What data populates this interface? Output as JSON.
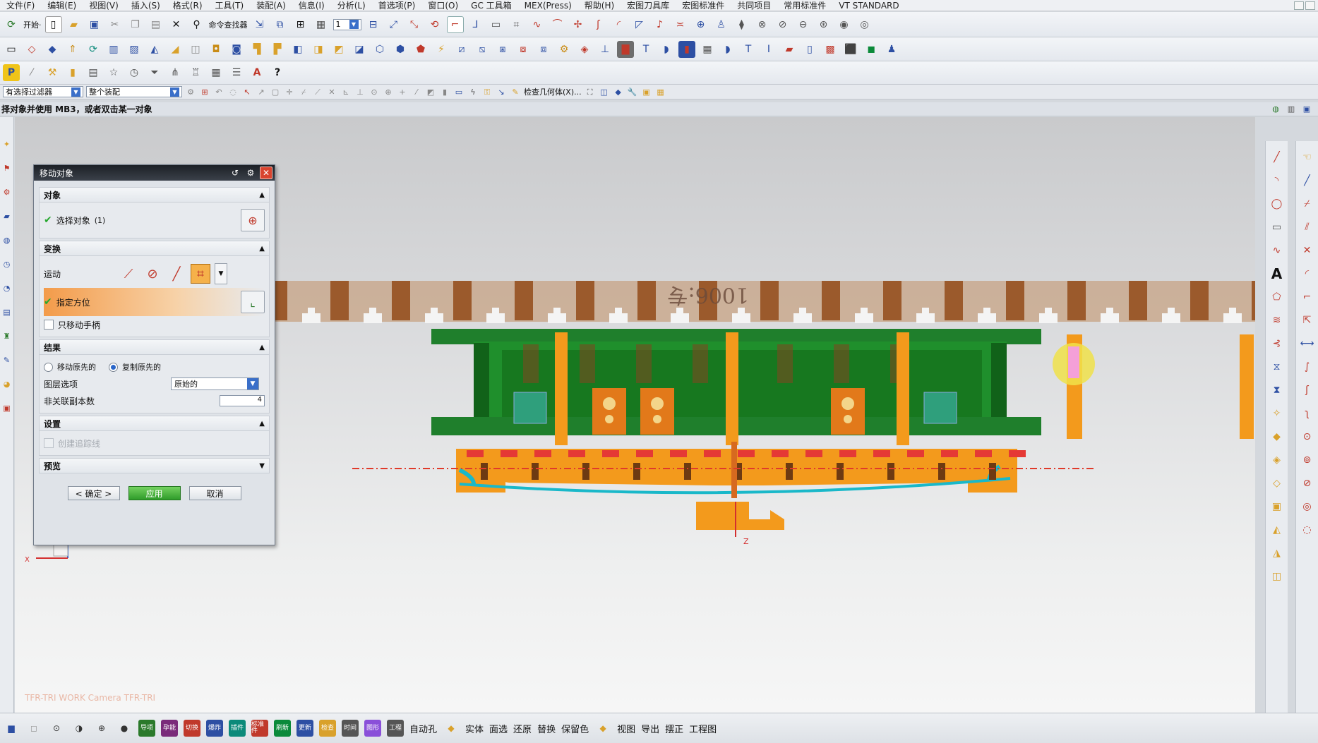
{
  "menubar": {
    "items": [
      "文件(F)",
      "编辑(E)",
      "视图(V)",
      "插入(S)",
      "格式(R)",
      "工具(T)",
      "装配(A)",
      "信息(I)",
      "分析(L)",
      "首选项(P)",
      "窗口(O)",
      "GC 工具箱",
      "MEX(Press)",
      "帮助(H)",
      "宏图刀具库",
      "宏图标准件",
      "共同项目",
      "常用标准件",
      "VT STANDARD"
    ]
  },
  "toolbar1": {
    "start_label": "开始·",
    "command_finder": "命令查找器",
    "layer_value": "1"
  },
  "toolbar4": {
    "filter_value": "有选择过滤器",
    "scope_value": "整个装配",
    "check_geometry": "检查几何体(X)..."
  },
  "cue_line": "择对象并使用 MB3，或者双击某一对象",
  "graphics": {
    "view_label": "TFR-TRI WORK Camera TFR-TRI",
    "stamp_text": "1006:专"
  },
  "dialog": {
    "title": "移动对象",
    "groups": {
      "object": {
        "header": "对象",
        "select_label": "选择对象",
        "select_count": "(1)"
      },
      "transform": {
        "header": "变换",
        "motion_label": "运动",
        "orient_label": "指定方位",
        "handles_only_label": "只移动手柄"
      },
      "result": {
        "header": "结果",
        "move_original": "移动原先的",
        "copy_original": "复制原先的",
        "layer_option_label": "图层选项",
        "layer_option_value": "原始的",
        "non_assoc_label": "非关联副本数",
        "non_assoc_value": "4"
      },
      "settings": {
        "header": "设置",
        "create_trace_label": "创建追踪线"
      },
      "preview": {
        "header": "预览"
      }
    },
    "buttons": {
      "ok": "< 确定 >",
      "apply": "应用",
      "cancel": "取消"
    }
  },
  "bottombar": {
    "labels": [
      "导项",
      "孕能",
      "切换",
      "爆炸",
      "插件",
      "标准件",
      "刷新",
      "更新",
      "检查",
      "时间",
      "图形",
      "工程",
      "自动孔",
      "实体",
      "面选",
      "还原",
      "替换",
      "保留色",
      "视图",
      "导出",
      "摆正",
      "工程图"
    ]
  },
  "colors": {
    "accent_green": "#2f9c2a",
    "mold_green": "#1f7f2c",
    "mold_orange": "#f39a1c",
    "highlight_orange": "#f39b4a"
  }
}
